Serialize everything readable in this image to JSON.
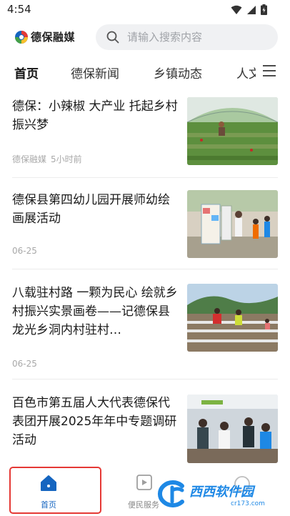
{
  "status_bar": {
    "time": "4:54"
  },
  "app": {
    "name": "德保融媒"
  },
  "search": {
    "placeholder": "请输入搜索内容"
  },
  "tabs": [
    {
      "label": "首页",
      "active": true
    },
    {
      "label": "德保新闻",
      "active": false
    },
    {
      "label": "乡镇动态",
      "active": false
    },
    {
      "label": "人文",
      "active": false
    }
  ],
  "articles": [
    {
      "title": "德保：小辣椒 大产业 托起乡村振兴梦",
      "source": "德保融媒",
      "time": "5小时前",
      "thumb_icon": "chili-field-photo"
    },
    {
      "title": "德保县第四幼儿园开展师幼绘画展活动",
      "source": "",
      "time": "06-25",
      "thumb_icon": "kindergarten-exhibition-photo"
    },
    {
      "title": "八载驻村路 一颗为民心 绘就乡村振兴实景画卷——记德保县龙光乡洞内村驻村…",
      "source": "",
      "time": "06-25",
      "thumb_icon": "farm-work-photo"
    },
    {
      "title": "百色市第五届人大代表德保代表团开展2025年年中专题调研活动",
      "source": "",
      "time": "",
      "thumb_icon": "meeting-photo"
    }
  ],
  "bottom_nav": [
    {
      "label": "首页",
      "active": true,
      "icon": "home-icon"
    },
    {
      "label": "便民服务",
      "active": false,
      "icon": "service-icon"
    },
    {
      "label": "",
      "active": false,
      "icon": "user-icon"
    }
  ],
  "watermark": {
    "brand": "西西软件园",
    "url": "cr173.com"
  },
  "colors": {
    "accent": "#1565c0",
    "highlight": "#e53935",
    "meta": "#a8a8a8"
  }
}
